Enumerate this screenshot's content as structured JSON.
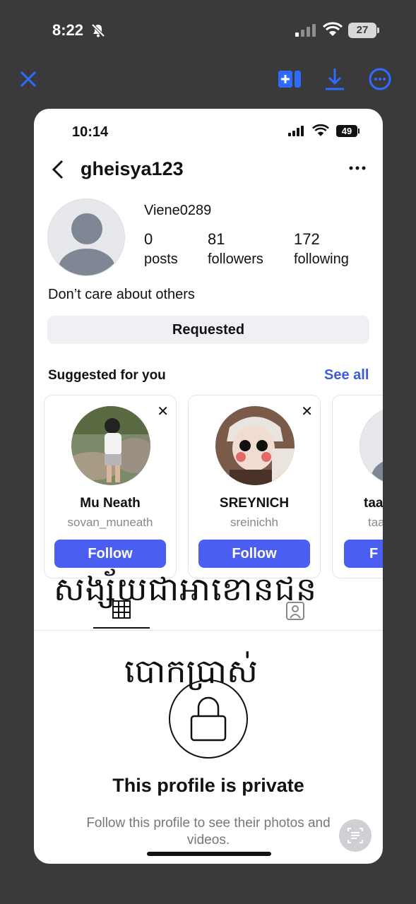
{
  "os_status": {
    "time": "8:22",
    "battery": "27"
  },
  "viewer_toolbar": {
    "icons": [
      "close-icon",
      "share-icon",
      "download-icon",
      "more-icon"
    ],
    "accent": "#2f6bff"
  },
  "inner_status": {
    "time": "10:14",
    "battery": "49"
  },
  "profile": {
    "username": "gheisya123",
    "display_name": "Viene0289",
    "stats": {
      "posts": {
        "value": "0",
        "label": "posts"
      },
      "followers": {
        "value": "81",
        "label": "followers"
      },
      "following": {
        "value": "172",
        "label": "following"
      }
    },
    "bio": "Don’t care about others",
    "requested_label": "Requested"
  },
  "suggestions": {
    "title": "Suggested for you",
    "see_all": "See all",
    "items": [
      {
        "name": "Mu Neath",
        "handle": "sovan_muneath",
        "follow": "Follow"
      },
      {
        "name": "SREYNICH",
        "handle": "sreinichh",
        "follow": "Follow"
      },
      {
        "name": "taa",
        "handle": "taa",
        "follow": "F"
      }
    ]
  },
  "overlay_text": {
    "line1": "សង្ស័យជាអាខោនជន",
    "line2": "បោកប្រាស់"
  },
  "private_notice": {
    "title": "This profile is private",
    "description": "Follow this profile to see their photos and videos."
  },
  "colors": {
    "follow_button": "#4a5ef2",
    "link": "#3b5bd8"
  }
}
